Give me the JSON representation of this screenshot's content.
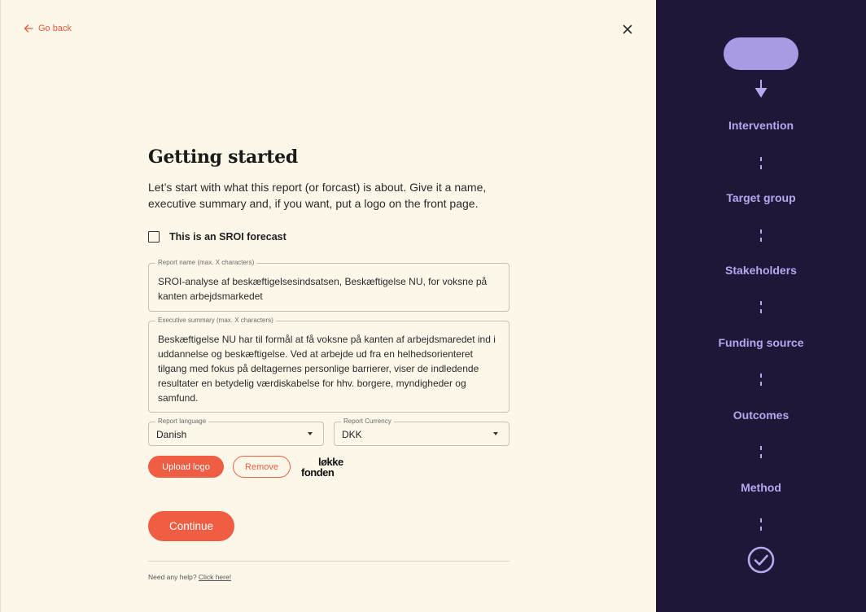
{
  "nav": {
    "back_label": "Go back"
  },
  "form": {
    "title": "Getting started",
    "intro": "Let’s start with what this report (or forcast) is about. Give it a name, executive summary and, if you want, put a logo on the front page.",
    "sroi_checkbox_label": "This is an SROI forecast",
    "sroi_checked": false,
    "report_name": {
      "label": "Report name (max. X characters)",
      "value": "SROI-analyse af beskæftigelsesindsatsen, Beskæftigelse NU, for voksne på kanten arbejdsmarkedet"
    },
    "summary": {
      "label": "Executive summary (max. X characters)",
      "value": "Beskæftigelse NU har til formål at få voksne på kanten af arbejdsmaredet ind i uddannelse og beskæftigelse. Ved at arbejde ud fra en helhedsorienteret tilgang med fokus på deltagernes personlige barrierer, viser de indledende resultater en betydelig værdiskabelse for hhv. borgere, myndigheder og samfund."
    },
    "language": {
      "label": "Report language",
      "value": "Danish"
    },
    "currency": {
      "label": "Report Currency",
      "value": "DKK"
    },
    "upload_label": "Upload logo",
    "remove_label": "Remove",
    "logo": {
      "line1": "løkke",
      "line2": "fonden"
    },
    "continue_label": "Continue",
    "help_text": "Need any help?",
    "help_link": "Click here!"
  },
  "steps": [
    {
      "label": "Intervention"
    },
    {
      "label": "Target group"
    },
    {
      "label": "Stakeholders"
    },
    {
      "label": "Funding source"
    },
    {
      "label": "Outcomes"
    },
    {
      "label": "Method"
    }
  ],
  "colors": {
    "accent": "#ef5e42",
    "background": "#fdf7ea",
    "sidebar": "#1f1638",
    "sidebar_text": "#b5a8ef",
    "pill": "#a99ae6"
  },
  "icons": {
    "back": "arrow-left-icon",
    "close": "close-icon",
    "flow_arrow": "arrow-down-icon",
    "done": "check-circle-icon"
  }
}
